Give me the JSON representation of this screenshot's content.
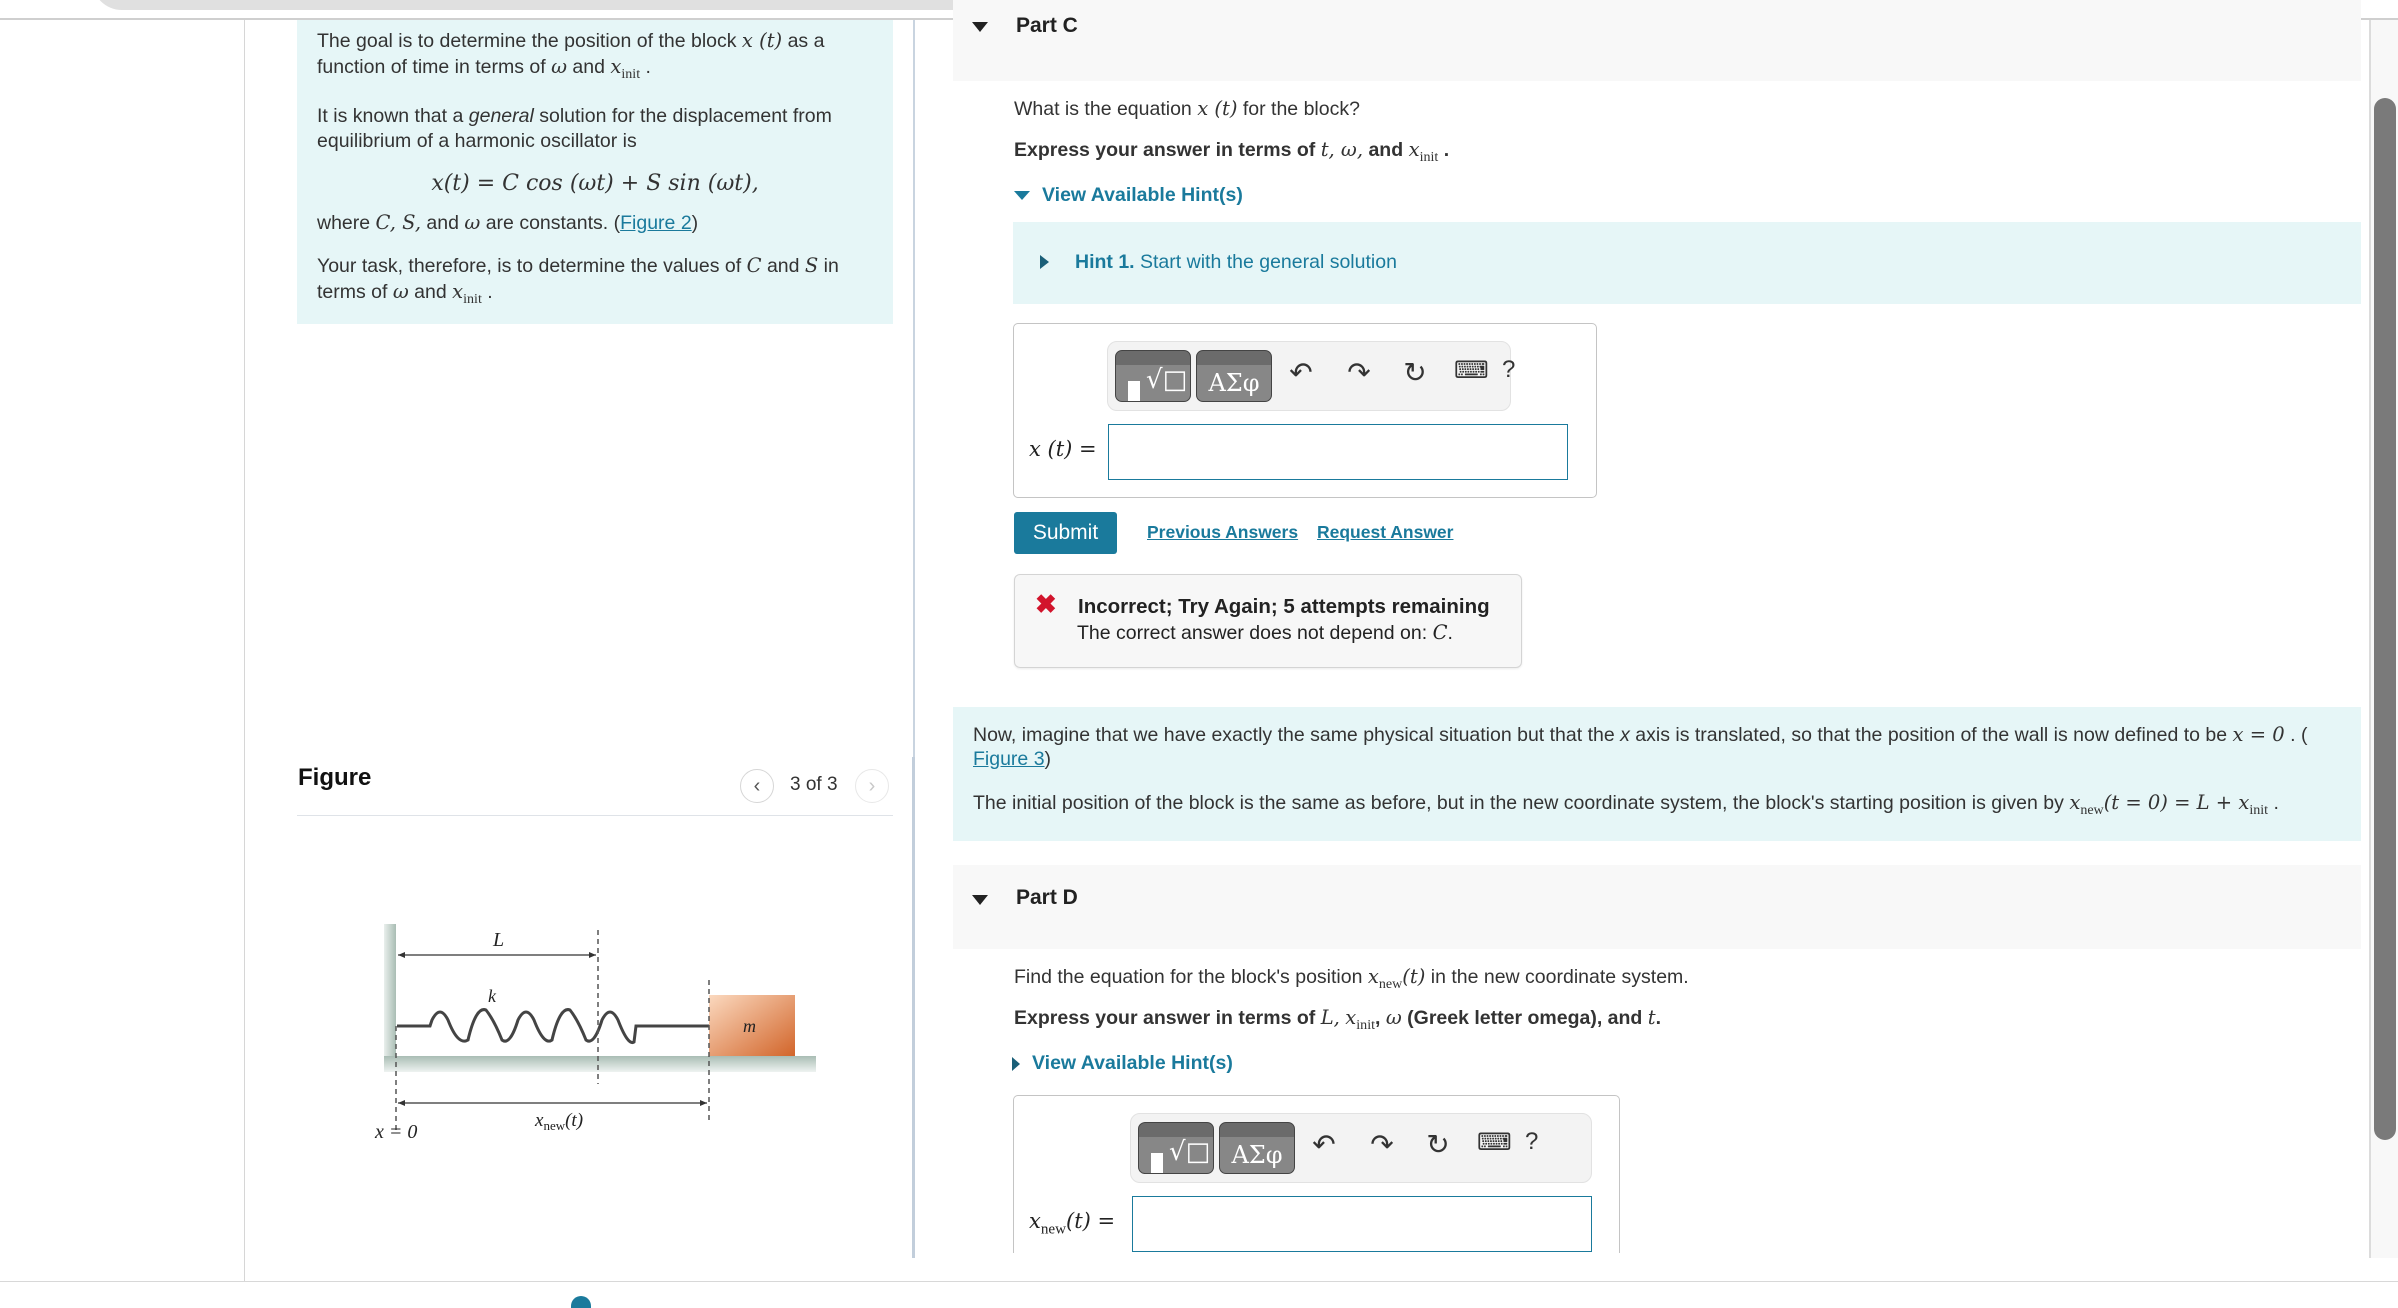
{
  "intro": {
    "p1_a": "The goal is to determine the position of the block ",
    "p1_math": "x (t)",
    "p1_b": " as a function of time in terms of ",
    "omega": "ω",
    "and": " and ",
    "xinit_x": "x",
    "xinit_sub": "init",
    "period": " .",
    "p2_a": "It is known that a ",
    "p2_em": "general",
    "p2_b": " solution for the displacement from equilibrium of a harmonic oscillator is",
    "equation": "x(t) = C cos (ωt) + S sin (ωt),",
    "p3_a": "where ",
    "p3_math": "C, S,",
    "p3_b": " and ",
    "p3_c": " are constants. (",
    "p3_link": "Figure 2",
    "p3_d": ")",
    "p4_a": "Your task, therefore, is to determine the values of ",
    "p4_C": "C",
    "p4_S": "S",
    "p4_b": " in terms of "
  },
  "figure": {
    "title": "Figure",
    "counter": "3 of 3",
    "prev_icon": "‹",
    "next_icon": "›",
    "labels": {
      "L": "L",
      "k": "k",
      "m": "m",
      "x0": "x = 0",
      "xnew": "x",
      "xnew_sub": "new",
      "xnew_arg": "(t)"
    }
  },
  "partC": {
    "title": "Part C",
    "question_a": "What is the equation ",
    "question_math": "x (t)",
    "question_b": " for the block?",
    "express_a": "Express your answer in terms of ",
    "express_math": "t, ω,",
    "express_b": " and ",
    "hints_label": "View Available Hint(s)",
    "hint1_bold": "Hint 1.",
    "hint1_text": " Start with the general solution",
    "answer_label": "x (t) =",
    "answer_value": "",
    "submit_label": "Submit",
    "previous_answers": "Previous Answers",
    "request_answer": "Request Answer",
    "feedback_title": "Incorrect; Try Again; 5 attempts remaining",
    "feedback_text": "The correct answer does not depend on: ",
    "feedback_var": "C",
    "feedback_icon": "✖"
  },
  "toolbar": {
    "templates_label": "√□",
    "greek_label": "ΑΣφ",
    "undo_icon": "↶",
    "redo_icon": "↷",
    "reset_icon": "↻",
    "keyboard_icon": "⌨",
    "help_label": "?"
  },
  "context": {
    "p1_a": "Now, imagine that we have exactly the same physical situation but that the ",
    "p1_x": "x",
    "p1_b": " axis is translated, so that the position of the wall is now defined to be ",
    "p1_math": "x = 0",
    "p1_c": " . (",
    "p1_link": "Figure 3",
    "p1_d": ")",
    "p2_a": "The initial position of the block is the same as before, but in the new coordinate system, the block's starting position is given by ",
    "p2_math_a": "(t = 0) = L + ",
    "p2_end": " ."
  },
  "partD": {
    "title": "Part D",
    "question_a": "Find the equation for the block's position ",
    "question_b": " in the new coordinate system.",
    "express_a": "Express your answer in terms of ",
    "express_L": "L,",
    "express_c": ", ",
    "express_d": " (Greek letter omega), and ",
    "express_t": "t",
    "express_end": ".",
    "hints_label": "View Available Hint(s)",
    "answer_label_arg": "(t) =",
    "answer_value": ""
  },
  "colors": {
    "accent": "#1a7a9c",
    "info_bg": "#e6f6f7",
    "error": "#d2142c"
  }
}
